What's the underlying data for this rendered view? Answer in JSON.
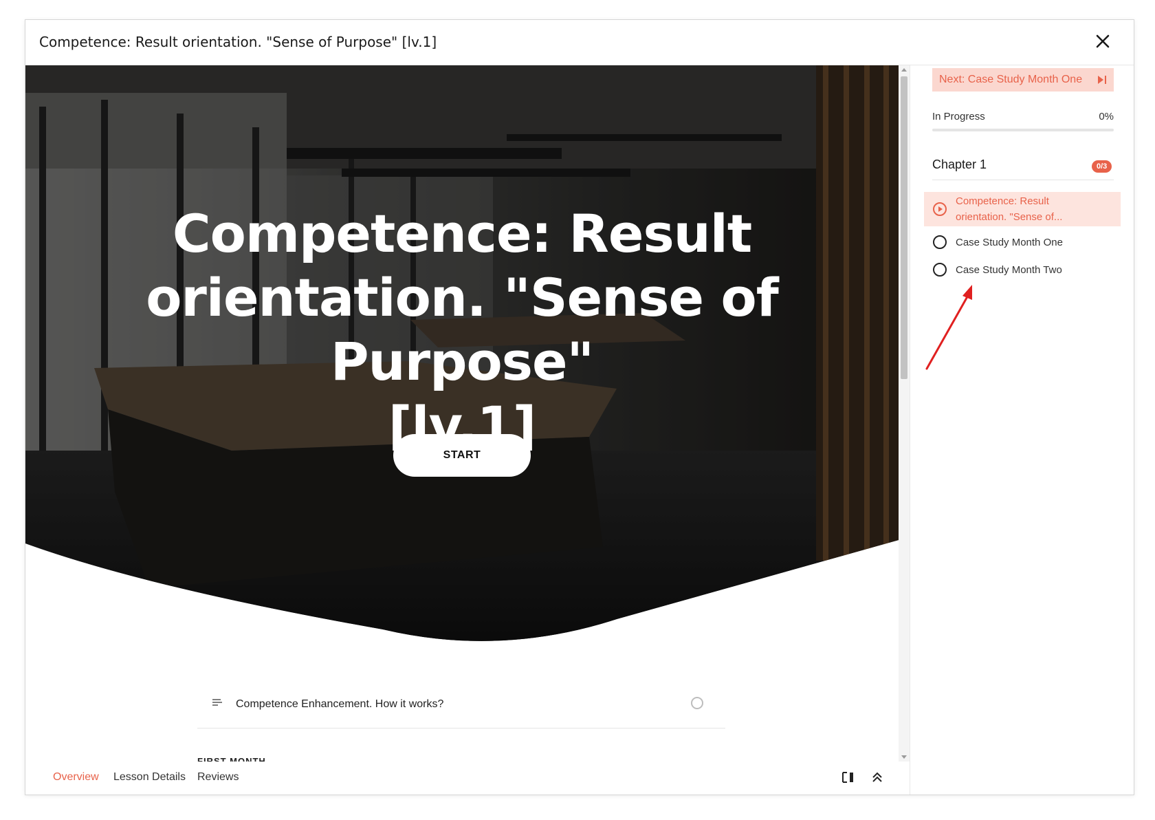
{
  "modal": {
    "title": "Competence: Result orientation. \"Sense of Purpose\" [lv.1]",
    "close_icon": "close-icon"
  },
  "hero": {
    "title_lines": [
      "Competence: Result",
      "orientation. \"Sense of Purpose\"",
      "[lv.1]"
    ],
    "start_label": "START"
  },
  "lesson_list": {
    "items": [
      {
        "icon": "lines-icon",
        "label": "Competence Enhancement. How it works?",
        "status_icon": "circle-icon"
      }
    ],
    "next_section_heading": "FIRST MONTH"
  },
  "bottom_bar": {
    "tabs": [
      {
        "label": "Overview",
        "active": true
      },
      {
        "label": "Lesson Details",
        "active": false
      },
      {
        "label": "Reviews",
        "active": false
      }
    ],
    "icons": [
      "sidebar-toggle-icon",
      "collapse-up-icon"
    ]
  },
  "sidebar": {
    "next_button": "Next: Case Study Month One",
    "progress": {
      "label": "In Progress",
      "value_text": "0%",
      "value": 0
    },
    "chapter": {
      "title": "Chapter 1",
      "badge": "0/3"
    },
    "items": [
      {
        "label_line1": "Competence: Result",
        "label_line2": "orientation. \"Sense of...",
        "icon": "play-circle-icon",
        "active": true
      },
      {
        "label": "Case Study Month One",
        "icon": "circle-icon",
        "active": false
      },
      {
        "label": "Case Study Month Two",
        "icon": "circle-icon",
        "active": false
      }
    ]
  },
  "colors": {
    "accent": "#e8624a",
    "accent_light": "#fde4de",
    "annotation_arrow": "#e02020"
  }
}
